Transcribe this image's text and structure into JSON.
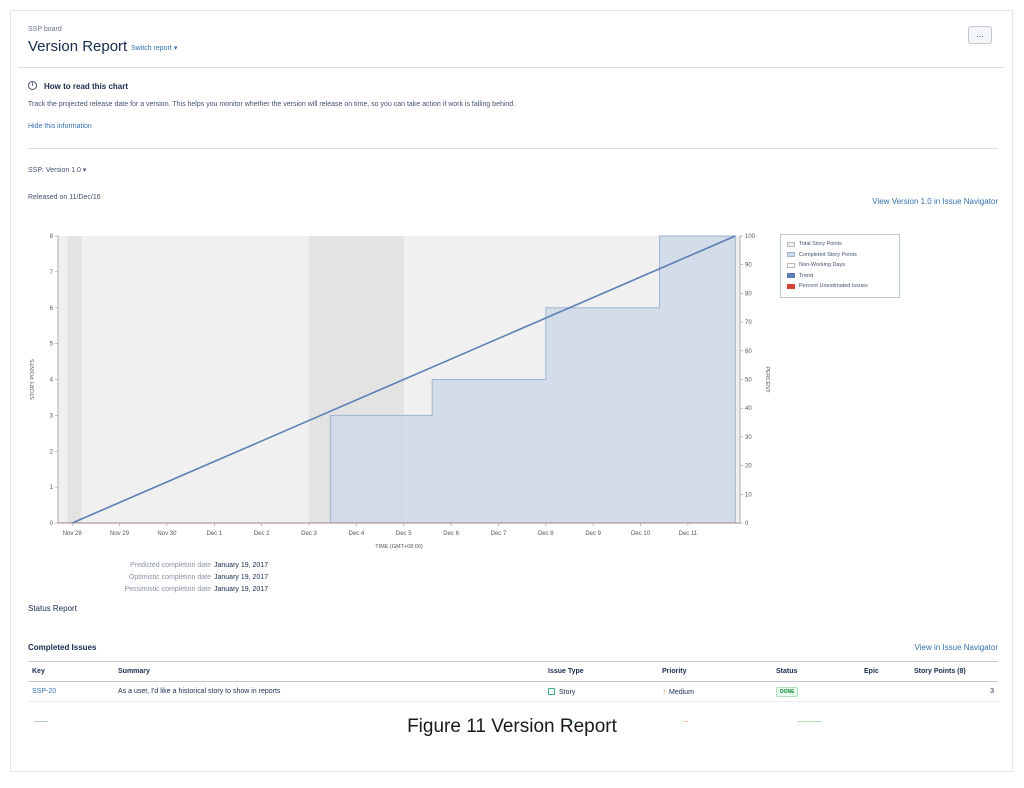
{
  "header": {
    "board_name": "SSP board",
    "title": "Version Report",
    "switch_report": "Switch report",
    "more_label": "..."
  },
  "info": {
    "icon": "info-icon",
    "title": "How to read this chart",
    "description": "Track the projected release date for a version. This helps you monitor whether the version will release on time, so you can take action if work is falling behind.",
    "hide_link": "Hide this information"
  },
  "version": {
    "selector": "SSP: Version 1.0",
    "released": "Released on 11/Dec/16",
    "view_link": "View Version 1.0 in Issue Navigator"
  },
  "chart_data": {
    "type": "area",
    "xlabel": "TIME (GMT+08:00)",
    "ylabel_left": "STORY POINTS",
    "ylabel_right": "PERCENT",
    "x": [
      "Nov 28",
      "Nov 29",
      "Nov 30",
      "Dec 1",
      "Dec 2",
      "Dec 3",
      "Dec 4",
      "Dec 5",
      "Dec 6",
      "Dec 7",
      "Dec 8",
      "Dec 9",
      "Dec 10",
      "Dec 11"
    ],
    "ylim_left": [
      0,
      8
    ],
    "yticks_left": [
      0,
      1,
      2,
      3,
      4,
      5,
      6,
      7,
      8
    ],
    "ylim_right": [
      0,
      100
    ],
    "yticks_right": [
      0,
      10,
      20,
      30,
      40,
      50,
      60,
      70,
      80,
      90,
      100
    ],
    "non_working_days": [
      [
        "Nov 27.8",
        "Nov 28.1"
      ],
      [
        "Dec 3",
        "Dec 5"
      ]
    ],
    "series": [
      {
        "name": "Total Story Points",
        "values": [
          8,
          8,
          8,
          8,
          8,
          8,
          8,
          8,
          8,
          8,
          8,
          8,
          8,
          8
        ]
      },
      {
        "name": "Completed Story Points",
        "steps": [
          [
            0.0,
            0
          ],
          [
            5.45,
            0
          ],
          [
            5.45,
            3
          ],
          [
            7.6,
            3
          ],
          [
            7.6,
            4
          ],
          [
            10.0,
            4
          ],
          [
            10.0,
            6
          ],
          [
            12.4,
            6
          ],
          [
            12.4,
            8
          ],
          [
            14.0,
            8
          ]
        ]
      },
      {
        "name": "Trend",
        "line": [
          [
            0,
            0
          ],
          [
            14.0,
            8
          ]
        ]
      },
      {
        "name": "Percent Unestimated Issues",
        "values": [
          0,
          0,
          0,
          0,
          0,
          0,
          0,
          0,
          0,
          0,
          0,
          0,
          0,
          0
        ]
      }
    ],
    "legend": [
      "Total Story Points",
      "Completed Story Points",
      "Non-Working Days",
      "Trend",
      "Percent Unestimated Issues"
    ],
    "legend_position": "right",
    "colors": {
      "total": "#f0f0f0",
      "completed": "#ccd9e8",
      "completed_line": "#9fb5d1",
      "non_working": "#e3e3e3",
      "trend": "#5b7fb5",
      "unestimated": "#d04437"
    }
  },
  "predictions": [
    {
      "label": "Predicted completion date",
      "value": "January 19, 2017"
    },
    {
      "label": "Optimistic completion date",
      "value": "January 19, 2017"
    },
    {
      "label": "Pessimistic completion date",
      "value": "January 19, 2017"
    }
  ],
  "status": {
    "title": "Status Report",
    "completed_title": "Completed Issues",
    "issue_nav_link": "View in Issue Navigator"
  },
  "table": {
    "headers": [
      "Key",
      "Summary",
      "Issue Type",
      "Priority",
      "Status",
      "Epic",
      "Story Points (8)"
    ],
    "rows": [
      {
        "key": "SSP-20",
        "summary": "As a user, I'd like a historical story to show in reports",
        "type": "Story",
        "priority": "Medium",
        "status": "DONE",
        "epic": "",
        "points": "3"
      }
    ]
  },
  "caption": "Figure 11 Version Report"
}
